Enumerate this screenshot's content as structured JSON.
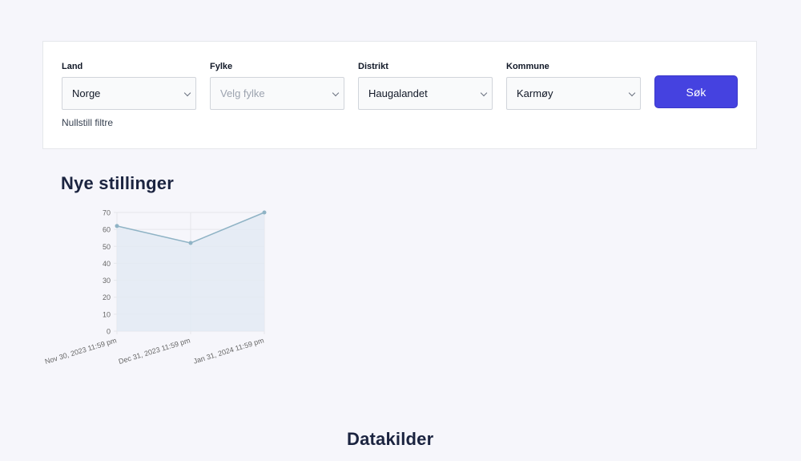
{
  "filters": {
    "land": {
      "label": "Land",
      "value": "Norge"
    },
    "fylke": {
      "label": "Fylke",
      "placeholder": "Velg fylke"
    },
    "distrikt": {
      "label": "Distrikt",
      "value": "Haugalandet"
    },
    "kommune": {
      "label": "Kommune",
      "value": "Karmøy"
    },
    "search_label": "Søk",
    "reset_label": "Nullstill filtre"
  },
  "sections": {
    "new_jobs_title": "Nye stillinger",
    "sources_title": "Datakilder"
  },
  "colors": {
    "accent": "#4542e0",
    "line": "#8fb3c5",
    "area": "#e3eaf3"
  },
  "chart_data": {
    "type": "area",
    "x": [
      "Nov 30, 2023 11:59 pm",
      "Dec 31, 2023 11:59 pm",
      "Jan 31, 2024 11:59 pm"
    ],
    "series": [
      {
        "values": [
          62,
          52,
          70
        ]
      }
    ],
    "yticks": [
      0,
      10,
      20,
      30,
      40,
      50,
      60,
      70
    ],
    "ylim": [
      0,
      70
    ],
    "grid": true,
    "legend": "none"
  }
}
